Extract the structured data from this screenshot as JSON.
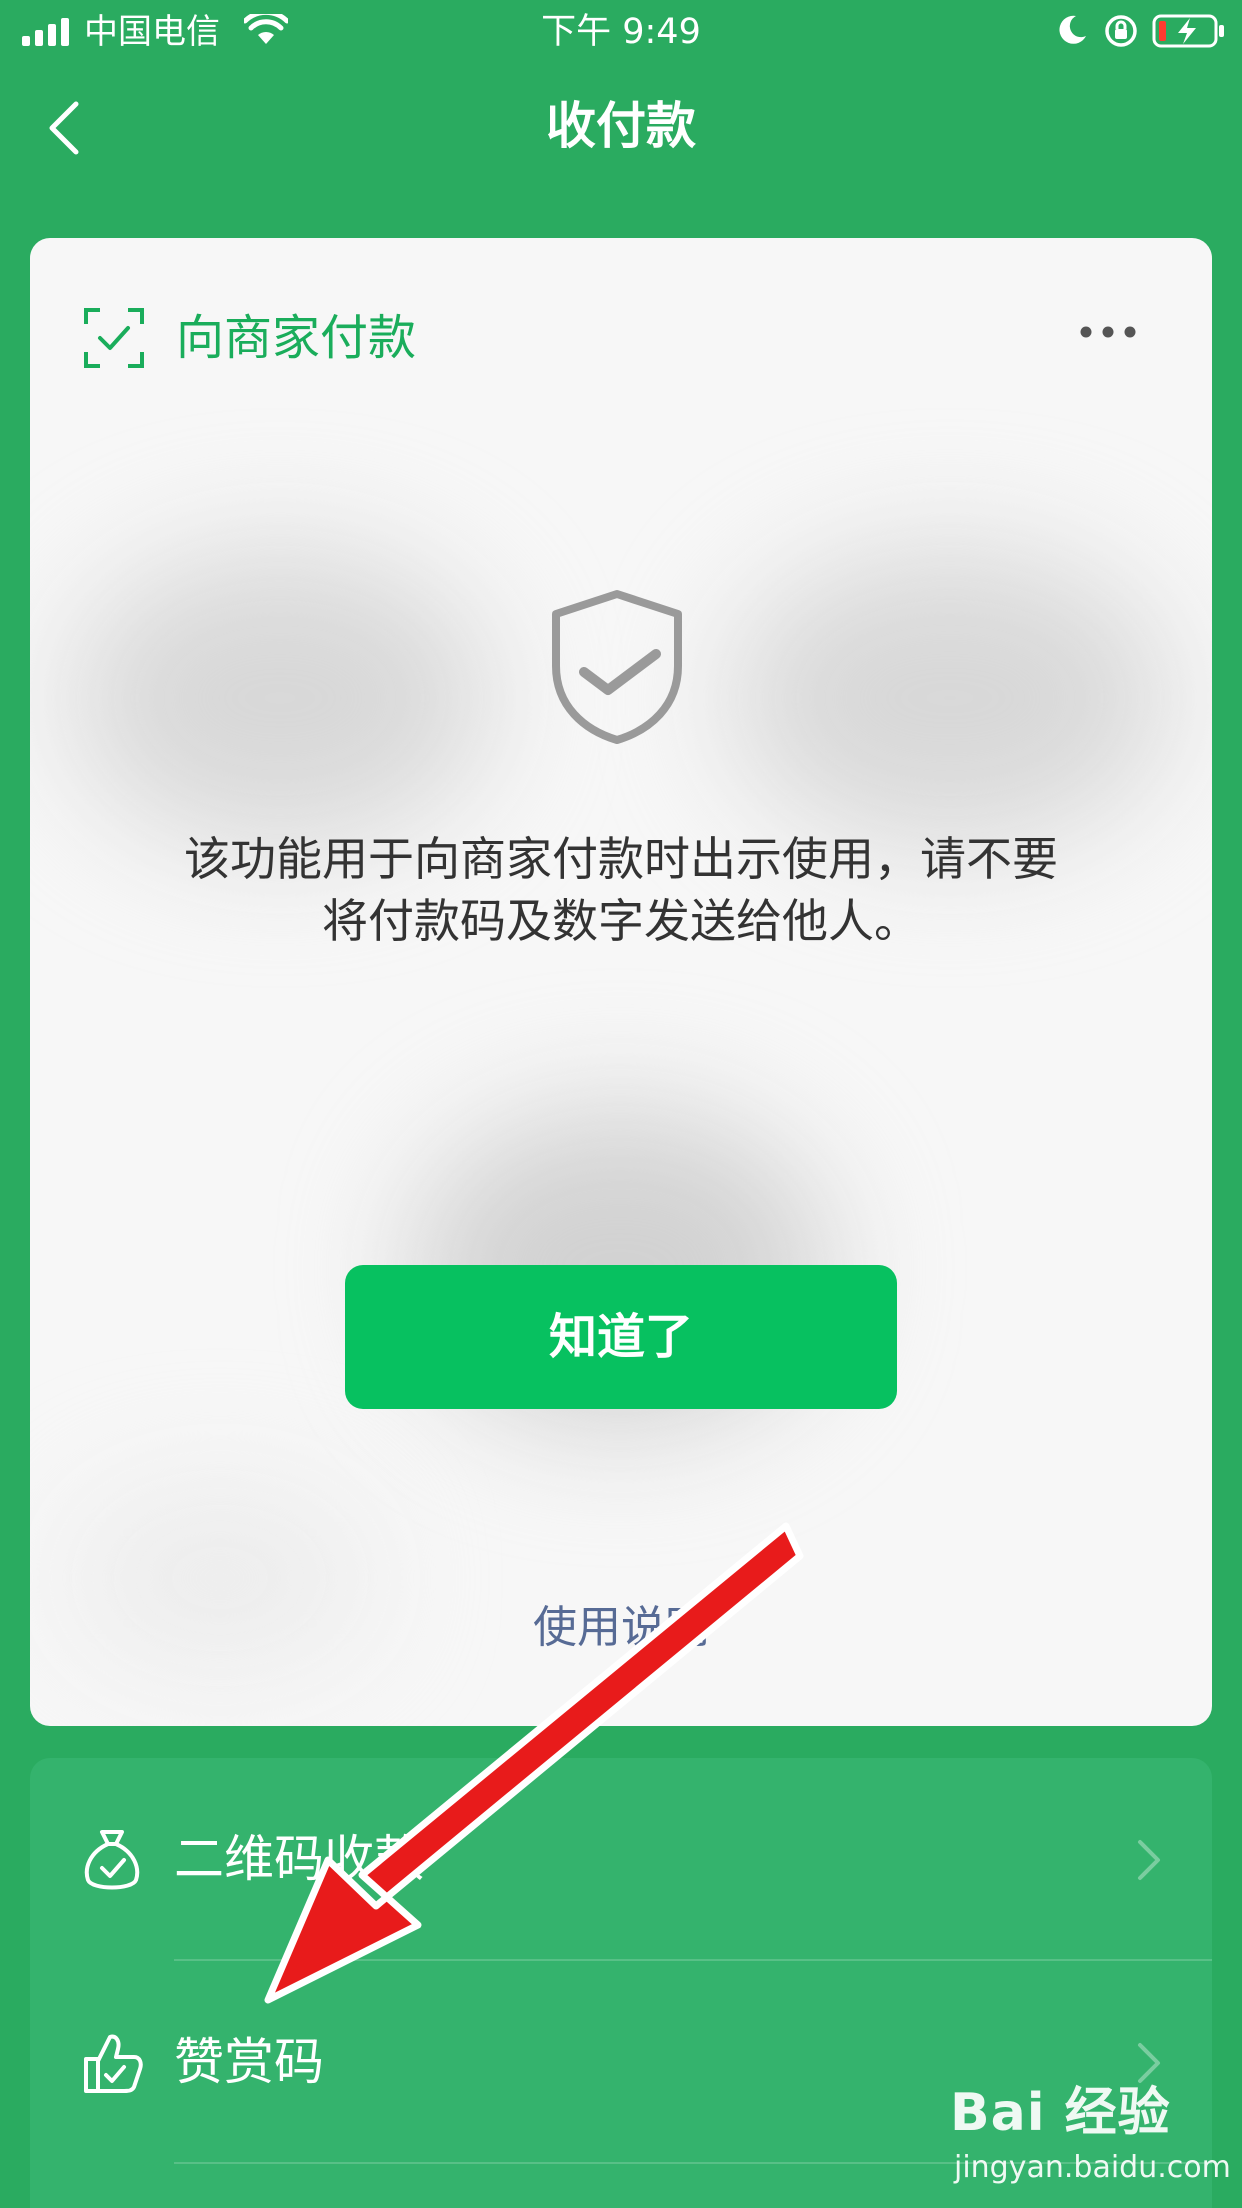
{
  "status_bar": {
    "carrier": "中国电信",
    "time": "下午 9:49"
  },
  "nav": {
    "title": "收付款"
  },
  "pay_card": {
    "title": "向商家付款",
    "notice_line1": "该功能用于向商家付款时出示使用，请不要",
    "notice_line2": "将付款码及数字发送给他人。",
    "ok_button": "知道了",
    "usage_link": "使用说明"
  },
  "options": [
    {
      "label": "二维码收款",
      "icon": "money-bag-icon"
    },
    {
      "label": "赞赏码",
      "icon": "thumbs-up-icon"
    }
  ],
  "watermark": {
    "logo": "Bai 经验",
    "url": "jingyan.baidu.com"
  },
  "colors": {
    "background": "#2aab60",
    "card": "#f7f7f7",
    "accent": "#07c160",
    "title_green": "#1aad5b",
    "link_blue": "#576b95",
    "annotation_red": "#e81b1b"
  }
}
